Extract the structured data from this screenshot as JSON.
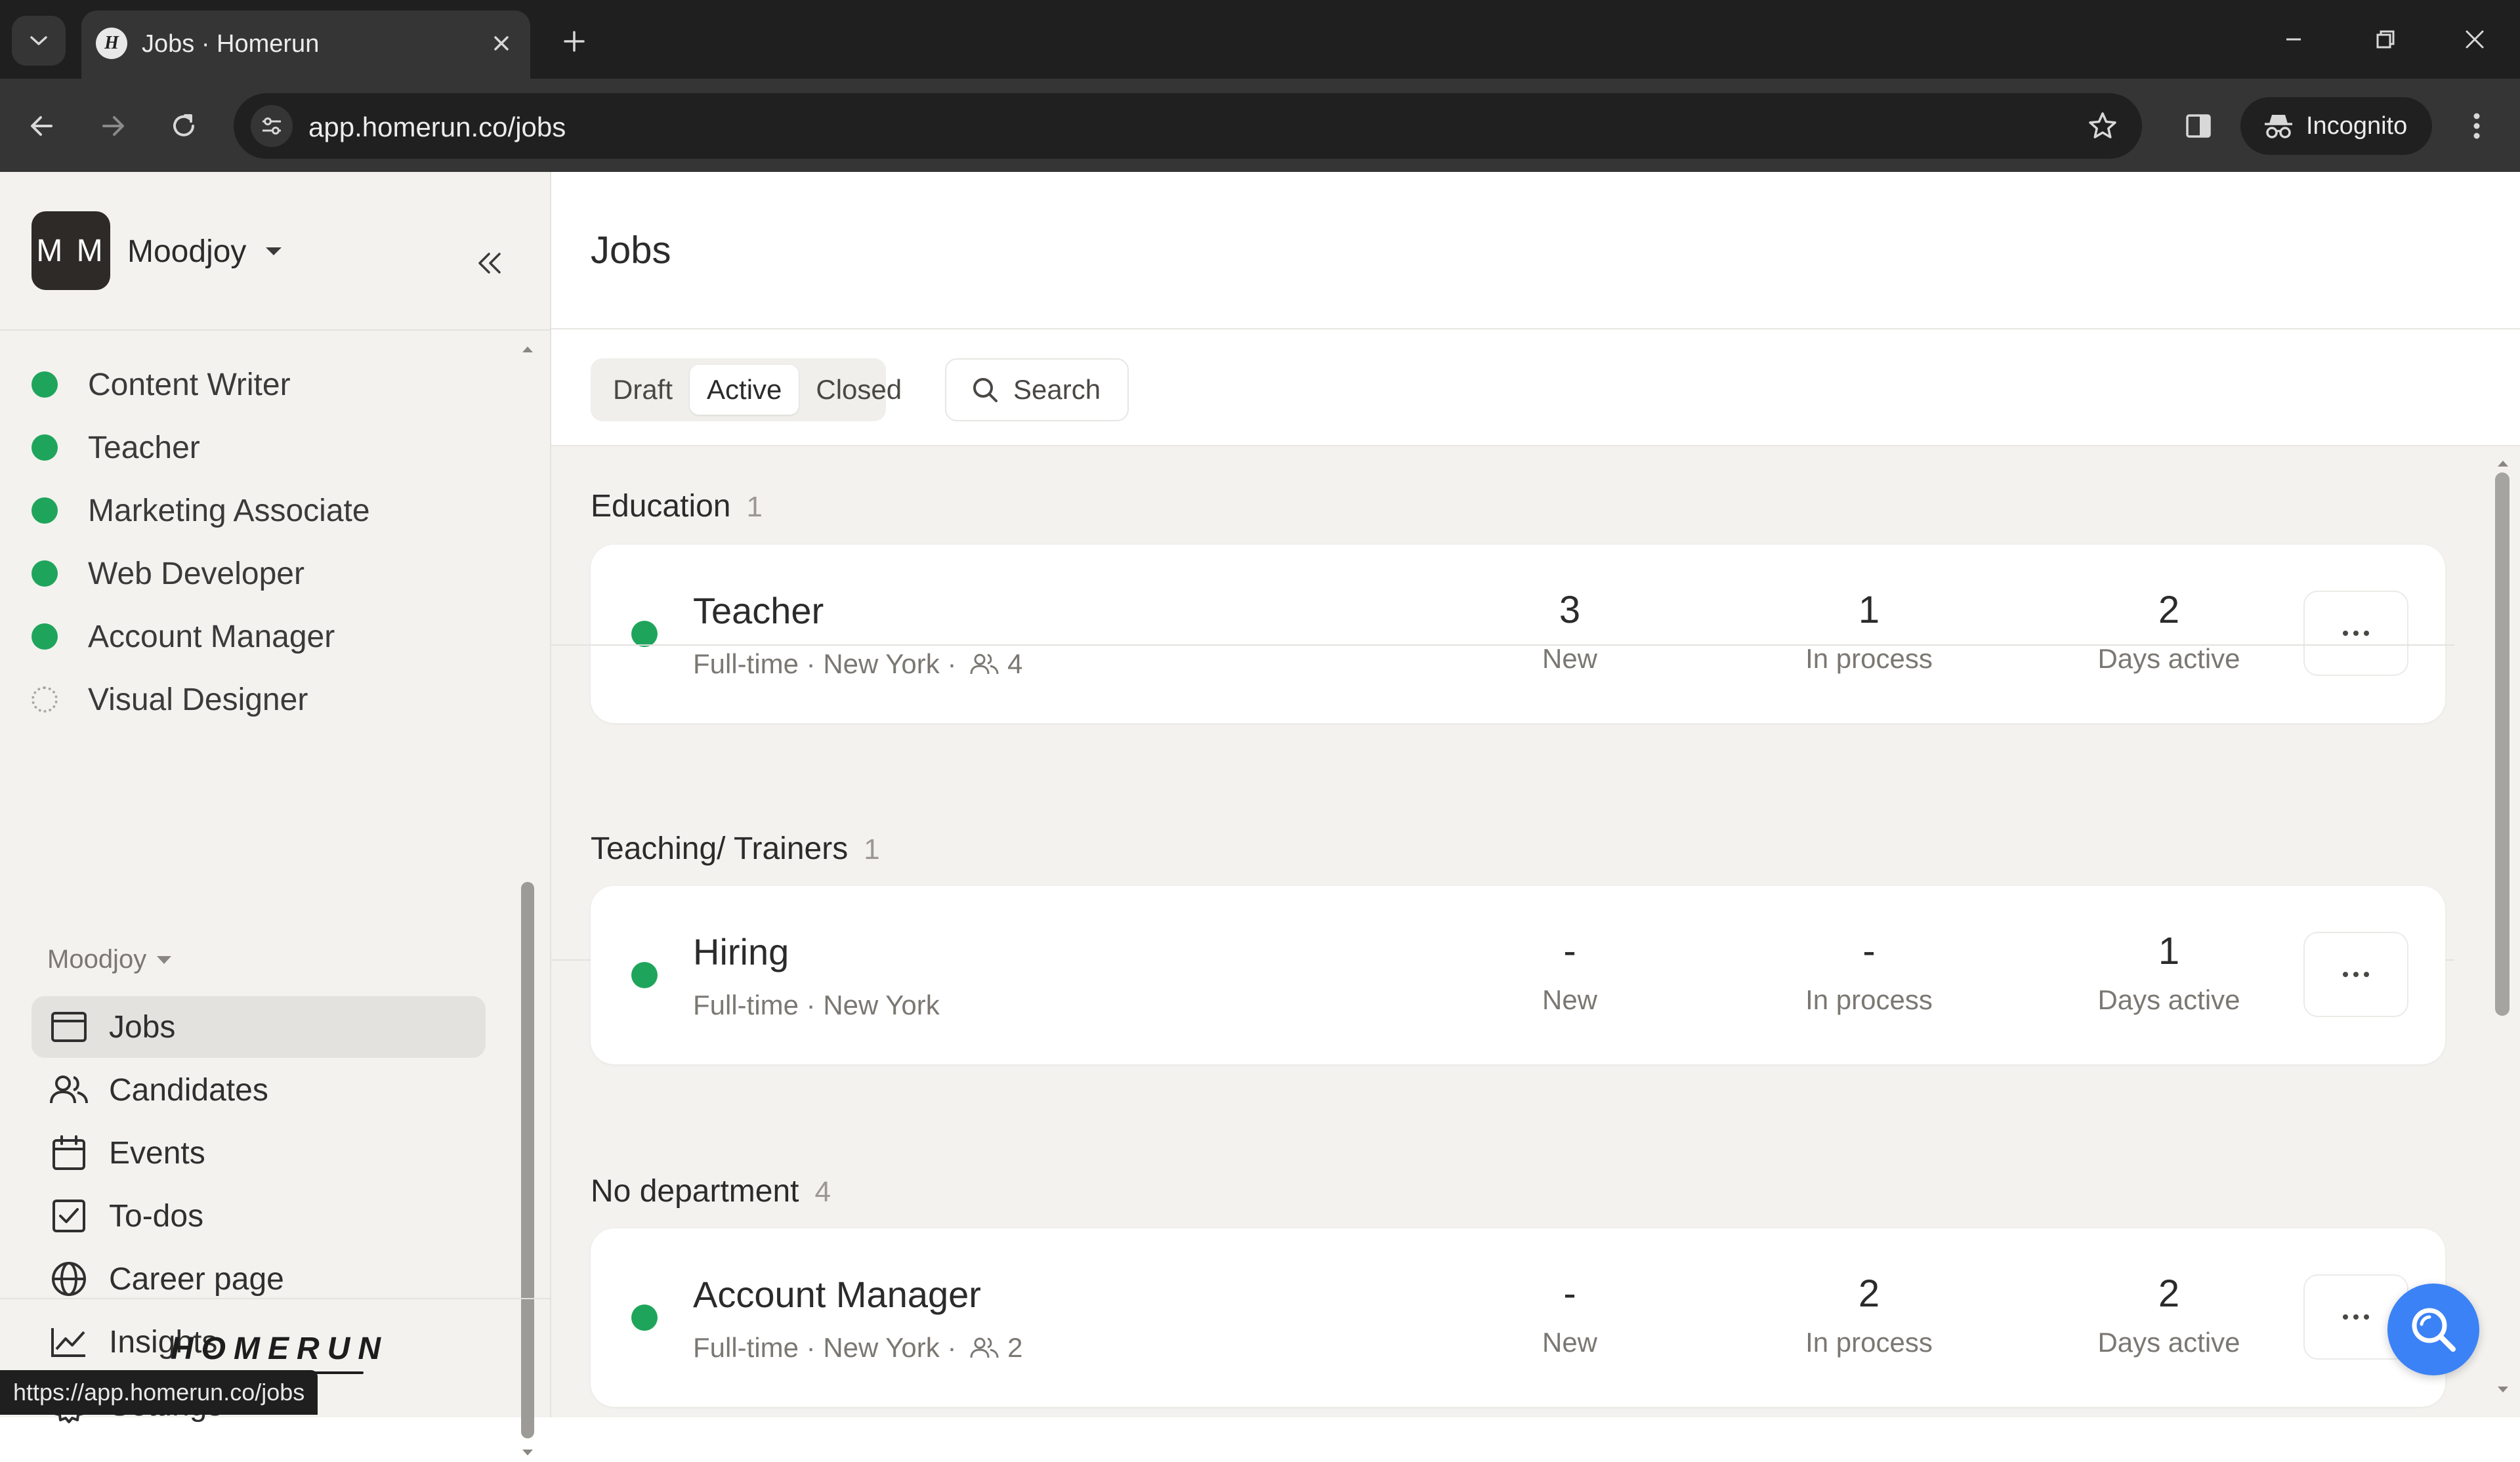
{
  "browser": {
    "tab_title": "Jobs · Homerun",
    "favicon_letter": "H",
    "url": "app.homerun.co/jobs",
    "profile_label": "Incognito",
    "status_url": "https://app.homerun.co/jobs"
  },
  "sidebar": {
    "org_initials": "M M",
    "org_name": "Moodjoy",
    "jobs": [
      {
        "label": "Content Writer",
        "status": "active"
      },
      {
        "label": "Teacher",
        "status": "active"
      },
      {
        "label": "Marketing Associate",
        "status": "active"
      },
      {
        "label": "Web Developer",
        "status": "active"
      },
      {
        "label": "Account Manager",
        "status": "active"
      },
      {
        "label": "Visual Designer",
        "status": "draft"
      }
    ],
    "section_label": "Moodjoy",
    "nav": [
      {
        "label": "Jobs",
        "icon": "browser-window-icon",
        "active": true
      },
      {
        "label": "Candidates",
        "icon": "people-icon",
        "active": false
      },
      {
        "label": "Events",
        "icon": "calendar-icon",
        "active": false
      },
      {
        "label": "To-dos",
        "icon": "checkbox-icon",
        "active": false
      },
      {
        "label": "Career page",
        "icon": "globe-icon",
        "active": false
      },
      {
        "label": "Insights",
        "icon": "line-chart-icon",
        "active": false
      },
      {
        "label": "Settings",
        "icon": "gear-icon",
        "active": false
      }
    ],
    "brand": "HOMERUN"
  },
  "main": {
    "title": "Jobs",
    "filters": [
      {
        "label": "Draft",
        "active": false
      },
      {
        "label": "Active",
        "active": true
      },
      {
        "label": "Closed",
        "active": false
      }
    ],
    "search_label": "Search",
    "departments": [
      {
        "name": "Education",
        "count": "1",
        "jobs": [
          {
            "title": "Teacher",
            "type": "Full-time",
            "location": "New York",
            "people": "4",
            "new": "3",
            "new_label": "New",
            "in_process": "1",
            "in_process_label": "In process",
            "days_active": "2",
            "days_active_label": "Days active"
          }
        ]
      },
      {
        "name": "Teaching/ Trainers",
        "count": "1",
        "jobs": [
          {
            "title": "Hiring",
            "type": "Full-time",
            "location": "New York",
            "people": "",
            "new": "-",
            "new_label": "New",
            "in_process": "-",
            "in_process_label": "In process",
            "days_active": "1",
            "days_active_label": "Days active"
          }
        ]
      },
      {
        "name": "No department",
        "count": "4",
        "jobs": [
          {
            "title": "Account Manager",
            "type": "Full-time",
            "location": "New York",
            "people": "2",
            "new": "-",
            "new_label": "New",
            "in_process": "2",
            "in_process_label": "In process",
            "days_active": "2",
            "days_active_label": "Days active"
          }
        ]
      }
    ]
  },
  "colors": {
    "active_dot": "#1fa55b",
    "help_button": "#3b82f6",
    "sidebar_bg": "#f3f2ef"
  }
}
